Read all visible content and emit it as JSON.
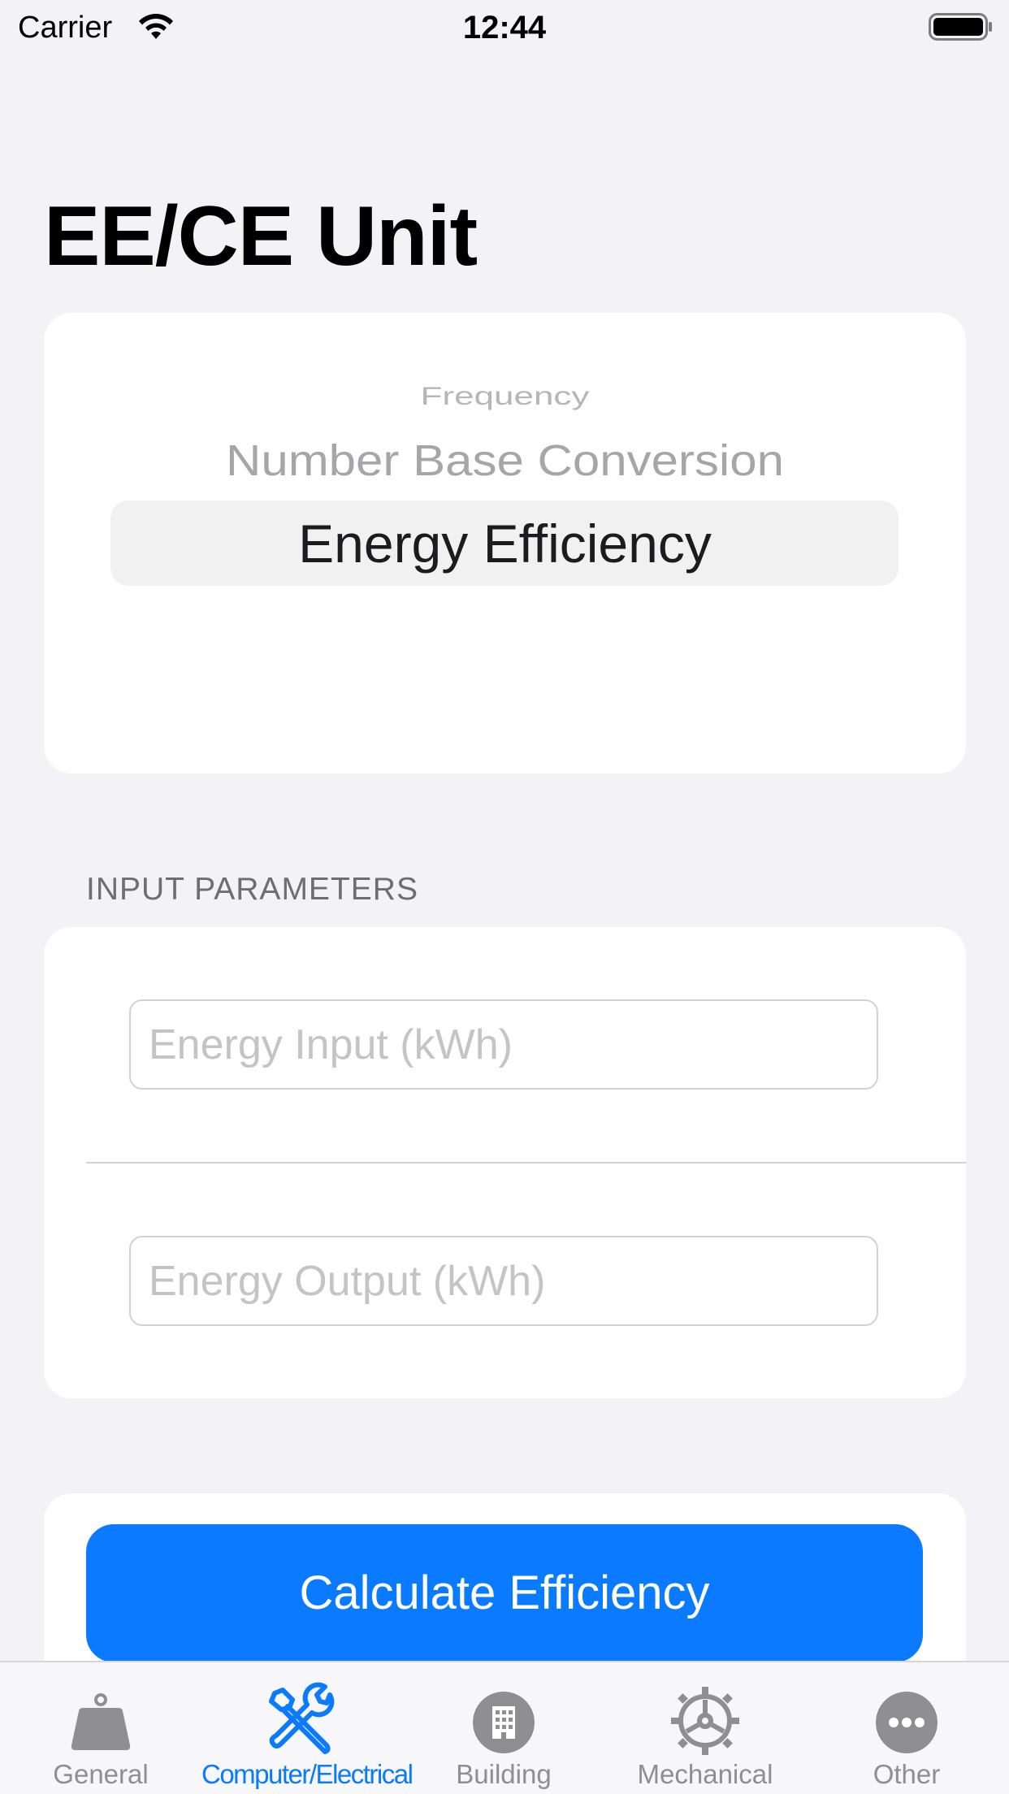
{
  "status_bar": {
    "carrier": "Carrier",
    "time": "12:44"
  },
  "title": "EE/CE Unit",
  "picker": {
    "items": [
      "Frequency",
      "Number Base Conversion",
      "Energy Efficiency"
    ],
    "selected": "Energy Efficiency"
  },
  "input_section": {
    "header": "INPUT PARAMETERS",
    "energy_input_placeholder": "Energy Input (kWh)",
    "energy_output_placeholder": "Energy Output (kWh)",
    "energy_input_value": "",
    "energy_output_value": ""
  },
  "calculate_button": {
    "label": "Calculate Efficiency"
  },
  "tab_bar": {
    "tabs": [
      {
        "label": "General",
        "icon": "weight-icon"
      },
      {
        "label": "Computer/Electrical",
        "icon": "tools-icon"
      },
      {
        "label": "Building",
        "icon": "building-icon"
      },
      {
        "label": "Mechanical",
        "icon": "gear-icon"
      },
      {
        "label": "Other",
        "icon": "ellipsis-icon"
      }
    ],
    "active": "Computer/Electrical"
  },
  "colors": {
    "accent": "#0a7aff",
    "background": "#f2f2f7",
    "inactive_tab": "#8e8e93"
  }
}
